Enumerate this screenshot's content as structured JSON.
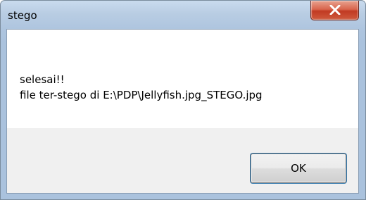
{
  "window": {
    "title": "stego"
  },
  "message": {
    "line1": "selesai!!",
    "line2": "file ter-stego di E:\\PDP\\Jellyfish.jpg_STEGO.jpg"
  },
  "buttons": {
    "ok_label": "OK",
    "close_icon": "close-icon"
  },
  "colors": {
    "close_button": "#c94a32",
    "titlebar": "#b9cde3",
    "footer": "#f0f0f0"
  }
}
